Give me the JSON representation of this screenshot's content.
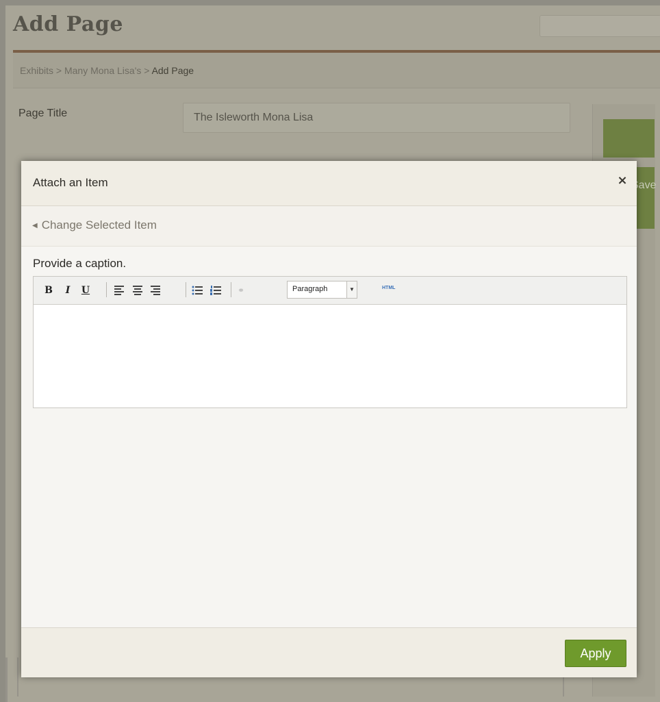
{
  "page": {
    "title": "Add Page",
    "breadcrumb": {
      "trail": "Exhibits > Many Mona Lisa's > ",
      "current": "Add Page"
    },
    "page_title_label": "Page Title",
    "page_title_value": "The Isleworth Mona Lisa",
    "save_fragment": "Save"
  },
  "modal": {
    "title": "Attach an Item",
    "close_icon": "×",
    "change_link": "Change Selected Item",
    "caption_label": "Provide a caption.",
    "toolbar": {
      "bold": "B",
      "italic": "I",
      "underline": "U",
      "link_icon": "⚭",
      "format_value": "Paragraph",
      "html_label": "HTML"
    },
    "editor_content": "",
    "apply_label": "Apply"
  },
  "colors": {
    "accent_green": "#6f9a2c",
    "title_rule": "#7a5f47"
  }
}
